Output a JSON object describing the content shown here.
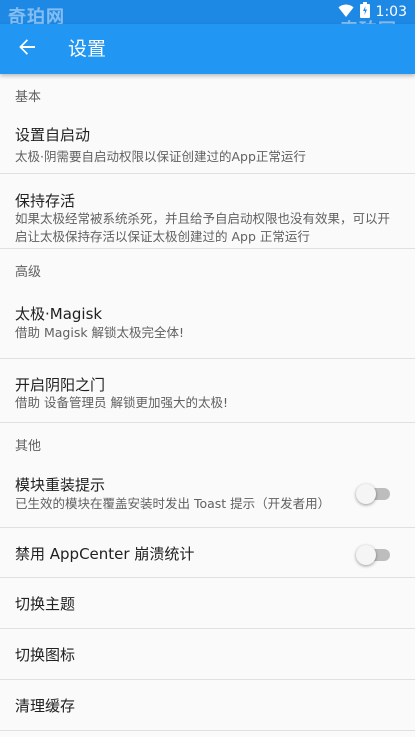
{
  "status_bar": {
    "time": "1:03",
    "watermark": "奇珀网",
    "icons": [
      "wifi-icon",
      "battery-icon"
    ]
  },
  "toolbar": {
    "title": "设置",
    "back_icon": "back-arrow-icon"
  },
  "colors": {
    "status_bar": "#1e88e5",
    "toolbar": "#2196f3",
    "background": "#fafafa"
  },
  "sections": {
    "basic": "基本",
    "advanced": "高级",
    "other": "其他"
  },
  "items": {
    "autostart": {
      "title": "设置自启动",
      "summary": "太极·阴需要自启动权限以保证创建过的App正常运行"
    },
    "keepalive": {
      "title": "保持存活",
      "summary": "如果太极经常被系统杀死，并且给予自启动权限也没有效果，可以开启让太极保持存活以保证太极创建过的 App 正常运行"
    },
    "magisk": {
      "title": "太极·Magisk",
      "summary": "借助 Magisk 解锁太极完全体!"
    },
    "yinyang": {
      "title": "开启阴阳之门",
      "summary": "借助 设备管理员 解锁更加强大的太极!"
    },
    "module_reinstall": {
      "title": "模块重装提示",
      "summary": "已生效的模块在覆盖安装时发出 Toast 提示（开发者用）",
      "enabled": false
    },
    "appcenter": {
      "title": "禁用 AppCenter 崩溃统计",
      "enabled": false
    },
    "theme": {
      "title": "切换主题"
    },
    "icon": {
      "title": "切换图标"
    },
    "cache": {
      "title": "清理缓存"
    }
  }
}
